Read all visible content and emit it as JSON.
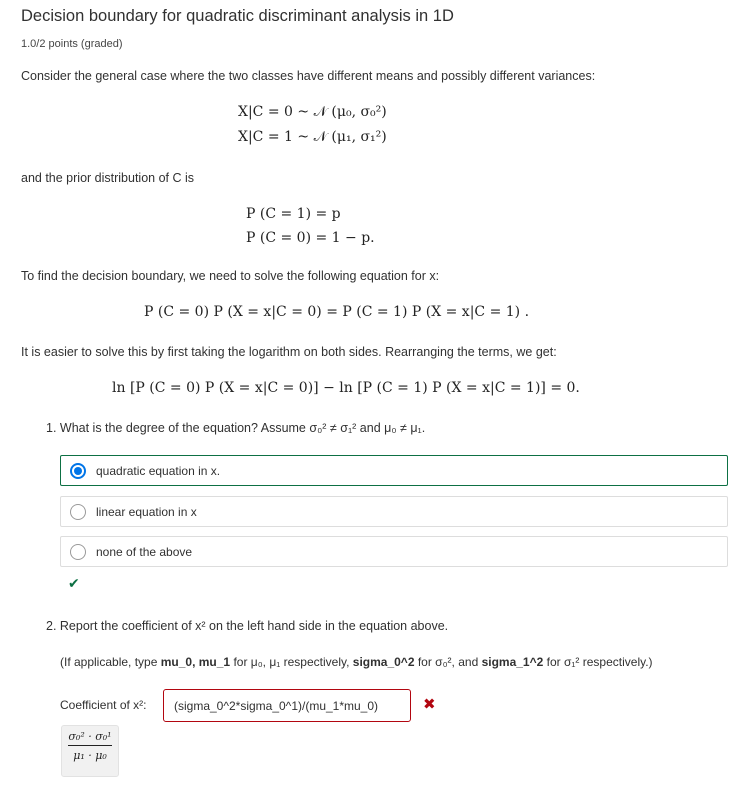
{
  "problem": {
    "title": "Decision boundary for quadratic discriminant analysis in 1D",
    "points": "1.0/2 points (graded)",
    "intro": "Consider the general case where the two classes have different means and possibly different variances:",
    "dist_eq_1": "X|C = 0  ~  𝒩 (μ₀, σ₀²)",
    "dist_eq_2": "X|C = 1  ~  𝒩 (μ₁, σ₁²)",
    "prior_text": "and the prior distribution of C is",
    "prior_eq_1": "P (C = 1)  =  p",
    "prior_eq_2": "P (C = 0)  =  1 − p.",
    "boundary_text": "To find the decision boundary, we need to solve the following equation for x:",
    "boundary_eq": "P (C = 0) P (X = x|C = 0) = P (C = 1) P (X = x|C = 1) .",
    "log_text": "It is easier to solve this by first taking the logarithm on both sides. Rearranging the terms, we get:",
    "log_eq": "ln [P (C = 0) P (X = x|C = 0)] − ln [P (C = 1) P (X = x|C = 1)]  =  0."
  },
  "question1": {
    "prompt": "1. What is the degree of the equation? Assume σ₀² ≠ σ₁² and μ₀ ≠ μ₁.",
    "choices": [
      {
        "label": "quadratic equation in x.",
        "selected": true
      },
      {
        "label": "linear equation in x",
        "selected": false
      },
      {
        "label": "none of the above",
        "selected": false
      }
    ],
    "status_icon": "checkmark-icon",
    "status_symbol": "✔",
    "status": "correct"
  },
  "question2": {
    "prompt": "2. Report the coefficient of x² on the left hand side in the equation above.",
    "hint_prefix": "(If applicable, type ",
    "hint_mu": "mu_0, mu_1",
    "hint_mid1": " for μ₀, μ₁ respectively, ",
    "hint_sigma0": "sigma_0^2",
    "hint_mid2": " for σ₀², and ",
    "hint_sigma1": "sigma_1^2",
    "hint_suffix": " for σ₁² respectively.)",
    "input_label": "Coefficient of x²:",
    "input_value": "(sigma_0^2*sigma_0^1)/(mu_1*mu_0)",
    "status_icon": "cross-icon",
    "status_symbol": "✖",
    "status": "incorrect",
    "preview_numerator": "σ₀² · σ₀¹",
    "preview_denominator": "μ₁ · μ₀"
  },
  "colors": {
    "correct": "#0d7044",
    "incorrect": "#b20610",
    "radio_selected": "#0075e8"
  }
}
